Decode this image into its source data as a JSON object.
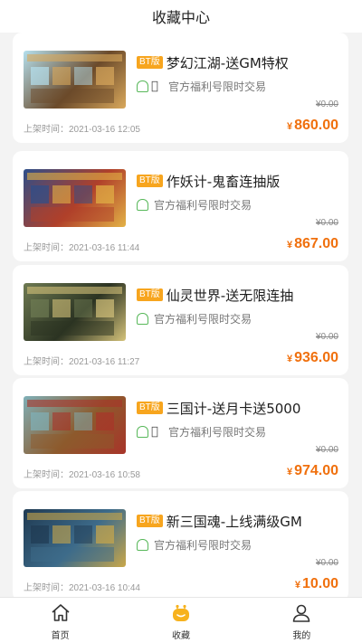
{
  "header": {
    "title": "收藏中心"
  },
  "games": [
    {
      "badge": "BT版",
      "title": "梦幻江湖-送GM特权",
      "platforms": [
        "android",
        "apple"
      ],
      "sub": "官方福利号限时交易",
      "old_price": "¥0.00",
      "date": "上架时间：2021-03-16 12:05",
      "currency": "¥",
      "price": "860.00",
      "thumb_colors": [
        "#b5e0ee",
        "#6b4a2a",
        "#d9a85c"
      ]
    },
    {
      "badge": "BT版",
      "title": "作妖计-鬼畜连抽版",
      "platforms": [
        "android"
      ],
      "sub": "官方福利号限时交易",
      "old_price": "¥0.00",
      "date": "上架时间：2021-03-16 11:44",
      "currency": "¥",
      "price": "867.00",
      "thumb_colors": [
        "#2d4e8a",
        "#b0402a",
        "#e3b246"
      ]
    },
    {
      "badge": "BT版",
      "title": "仙灵世界-送无限连抽",
      "platforms": [
        "android"
      ],
      "sub": "官方福利号限时交易",
      "old_price": "¥0.00",
      "date": "上架时间：2021-03-16 11:27",
      "currency": "¥",
      "price": "936.00",
      "thumb_colors": [
        "#6e7a52",
        "#2b3322",
        "#d4c27a"
      ]
    },
    {
      "badge": "BT版",
      "title": "三国计-送月卡送5000",
      "platforms": [
        "android",
        "apple"
      ],
      "sub": "官方福利号限时交易",
      "old_price": "¥0.00",
      "date": "上架时间：2021-03-16 10:58",
      "currency": "¥",
      "price": "974.00",
      "thumb_colors": [
        "#7fb0b8",
        "#8d5a2c",
        "#a8342a"
      ]
    },
    {
      "badge": "BT版",
      "title": "新三国魂-上线满级GM",
      "platforms": [
        "android"
      ],
      "sub": "官方福利号限时交易",
      "old_price": "¥0.00",
      "date": "上架时间：2021-03-16 10:44",
      "currency": "¥",
      "price": "10.00",
      "thumb_colors": [
        "#1f3a52",
        "#3d6b8a",
        "#c9a74a"
      ]
    }
  ],
  "tabs": [
    {
      "label": "首页",
      "icon": "home-icon",
      "active": false
    },
    {
      "label": "收藏",
      "icon": "favorites-icon",
      "active": true
    },
    {
      "label": "我的",
      "icon": "profile-icon",
      "active": false
    }
  ],
  "colors": {
    "accent": "#f7a51e",
    "price": "#f0700d"
  }
}
